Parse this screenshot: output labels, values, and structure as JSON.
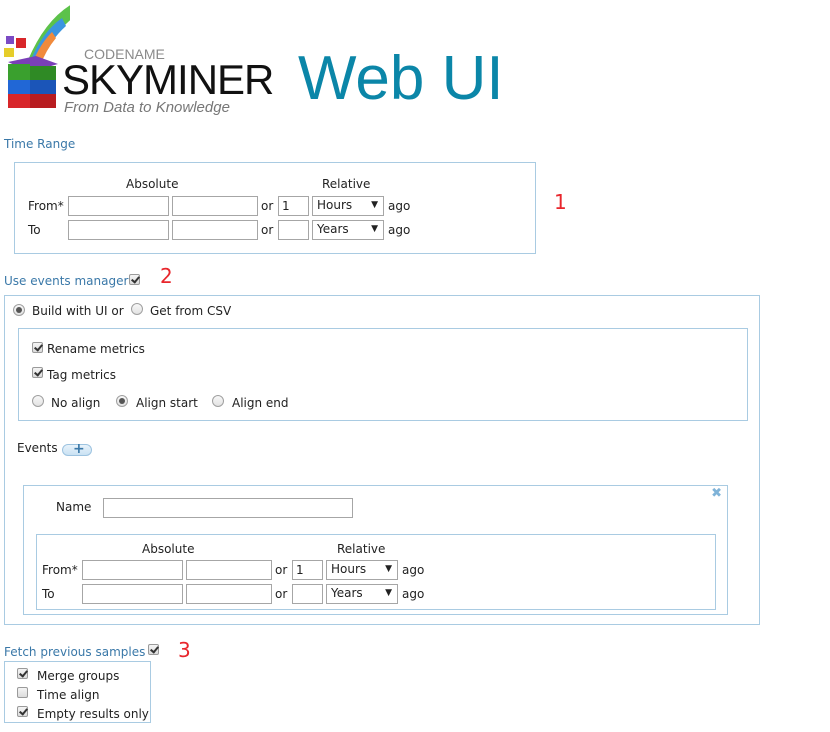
{
  "header": {
    "logo_codename": "CODENAME",
    "logo_name": "SKYMINER",
    "logo_tagline": "From Data to Knowledge",
    "title": "Web UI"
  },
  "time_range": {
    "label": "Time Range",
    "absolute_label": "Absolute",
    "relative_label": "Relative",
    "from_label": "From*",
    "to_label": "To",
    "or_label": "or",
    "ago_label": "ago",
    "from_date": "",
    "from_time": "",
    "from_relative_value": "1",
    "from_relative_unit": "Hours",
    "to_date": "",
    "to_time": "",
    "to_relative_value": "",
    "to_relative_unit": "Years",
    "annotation": "1"
  },
  "events_manager": {
    "label": "Use events manager",
    "checked": true,
    "annotation": "2",
    "source_options": [
      {
        "label": "Build with UI or",
        "selected": true
      },
      {
        "label": "Get from CSV",
        "selected": false
      }
    ],
    "options": {
      "rename_metrics": {
        "label": "Rename metrics",
        "checked": true
      },
      "tag_metrics": {
        "label": "Tag metrics",
        "checked": true
      },
      "align": [
        {
          "label": "No align",
          "selected": false
        },
        {
          "label": "Align start",
          "selected": true
        },
        {
          "label": "Align end",
          "selected": false
        }
      ]
    },
    "events_label": "Events",
    "add_event_icon": "plus-icon",
    "event": {
      "name_label": "Name",
      "name_value": "",
      "close_icon": "close-icon",
      "absolute_label": "Absolute",
      "relative_label": "Relative",
      "from_label": "From*",
      "to_label": "To",
      "or_label": "or",
      "ago_label": "ago",
      "from_relative_value": "1",
      "from_relative_unit": "Hours",
      "to_relative_value": "",
      "to_relative_unit": "Years"
    }
  },
  "fetch_previous": {
    "label": "Fetch previous samples",
    "checked": true,
    "annotation": "3",
    "options": [
      {
        "label": "Merge groups",
        "checked": true
      },
      {
        "label": "Time align",
        "checked": false
      },
      {
        "label": "Empty results only",
        "checked": true
      }
    ]
  }
}
